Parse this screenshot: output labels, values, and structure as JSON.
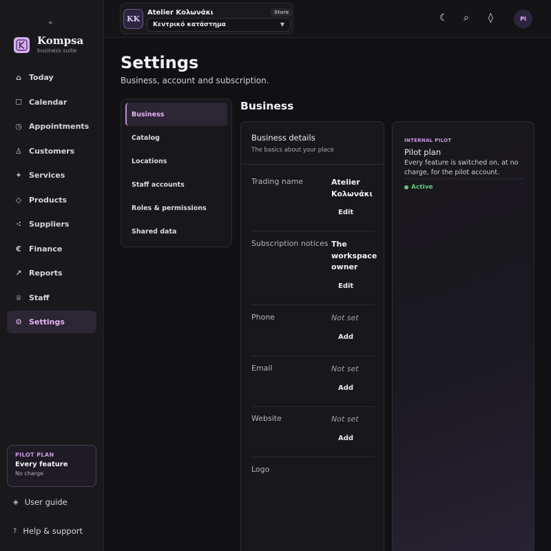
{
  "sidebar": {
    "collapse_icon": "«",
    "brand": {
      "name": "Kompsa",
      "subtitle": "business suite",
      "logo_letter": "K"
    },
    "items": [
      {
        "label": "Today",
        "icon": "home-icon",
        "glyph": "⌂"
      },
      {
        "label": "Calendar",
        "icon": "calendar-icon",
        "glyph": "☐"
      },
      {
        "label": "Appointments",
        "icon": "clock-icon",
        "glyph": "◷"
      },
      {
        "label": "Customers",
        "icon": "person-icon",
        "glyph": "♙"
      },
      {
        "label": "Services",
        "icon": "sparkle-icon",
        "glyph": "✦"
      },
      {
        "label": "Products",
        "icon": "tag-icon",
        "glyph": "◇"
      },
      {
        "label": "Suppliers",
        "icon": "network-icon",
        "glyph": "⁖"
      },
      {
        "label": "Finance",
        "icon": "euro-icon",
        "glyph": "€"
      },
      {
        "label": "Reports",
        "icon": "trend-arrow-icon",
        "glyph": "↗"
      },
      {
        "label": "Staff",
        "icon": "staff-icon",
        "glyph": "♕"
      },
      {
        "label": "Settings",
        "icon": "gear-icon",
        "glyph": "⚙",
        "active": true
      }
    ],
    "plan_card": {
      "kicker": "PILOT PLAN",
      "title": "Every feature",
      "subtitle": "No charge"
    },
    "user_guide": {
      "label": "User guide",
      "glyph": "◈"
    },
    "help": {
      "label": "Help & support",
      "glyph": "?"
    }
  },
  "topbar": {
    "store": {
      "initials": "KK",
      "name": "Atelier Κολωνάκι",
      "badge": "Store",
      "location": "Κεντρικό κατάστημα",
      "chevron": "▼"
    },
    "icons": {
      "moon": "☾",
      "search": "⌕",
      "diamond": "◊"
    },
    "user_initials": "PI"
  },
  "page": {
    "title": "Settings",
    "subtitle": "Business, account and subscription."
  },
  "subnav": [
    "Business",
    "Catalog",
    "Locations",
    "Staff accounts",
    "Roles & permissions",
    "Shared data"
  ],
  "section": {
    "title": "Business",
    "card": {
      "title": "Business details",
      "subtitle": "The basics about your place",
      "rows": [
        {
          "label": "Trading name",
          "value": "Atelier Κολωνάκι",
          "action": "Edit"
        },
        {
          "label": "Subscription notices",
          "value": "The workspace owner",
          "action": "Edit"
        },
        {
          "label": "Phone",
          "value": "Not set",
          "action": "Add"
        },
        {
          "label": "Email",
          "value": "Not set",
          "action": "Add"
        },
        {
          "label": "Website",
          "value": "Not set",
          "action": "Add"
        },
        {
          "label": "Logo"
        }
      ]
    }
  },
  "pilot": {
    "kicker": "INTERNAL PILOT",
    "title": "Pilot plan",
    "description": "Every feature is switched on, at no charge, for the pilot account.",
    "status": "Active"
  },
  "colors": {
    "accent": "#e7b4f7",
    "active_bg": "#2c2533",
    "success": "#5cc77c"
  }
}
